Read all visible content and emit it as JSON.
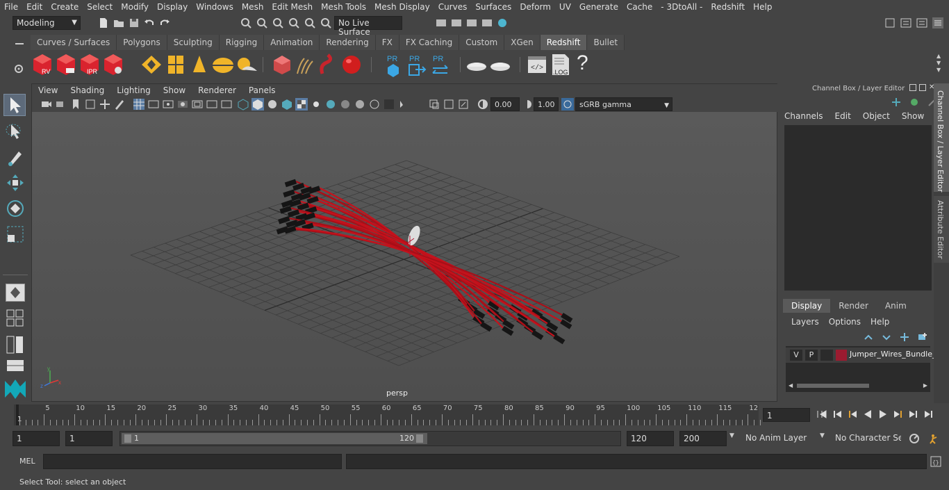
{
  "menubar": {
    "items": [
      "File",
      "Edit",
      "Create",
      "Select",
      "Modify",
      "Display",
      "Windows",
      "Mesh",
      "Edit Mesh",
      "Mesh Tools",
      "Mesh Display",
      "Curves",
      "Surfaces",
      "Deform",
      "UV",
      "Generate",
      "Cache",
      "- 3DtoAll -",
      "Redshift",
      "Help"
    ]
  },
  "statusline": {
    "mode": "Modeling",
    "live_surface": "No Live Surface"
  },
  "shelf": {
    "tabs": [
      "Curves / Surfaces",
      "Polygons",
      "Sculpting",
      "Rigging",
      "Animation",
      "Rendering",
      "FX",
      "FX Caching",
      "Custom",
      "XGen",
      "Redshift",
      "Bullet"
    ],
    "active_tab": "Redshift",
    "icons": {
      "rv": "RV",
      "ipr": "IPR",
      "pr": "PR",
      "log": ".LOG",
      "help": "?"
    }
  },
  "viewport": {
    "menu": [
      "View",
      "Shading",
      "Lighting",
      "Show",
      "Renderer",
      "Panels"
    ],
    "exposure": "0.00",
    "gamma": "1.00",
    "color_space": "sGRB gamma",
    "camera_label": "persp"
  },
  "channelbox": {
    "title": "Channel Box / Layer Editor",
    "menu": [
      "Channels",
      "Edit",
      "Object",
      "Show"
    ],
    "layer_tabs": [
      "Display",
      "Render",
      "Anim"
    ],
    "layer_menu": [
      "Layers",
      "Options",
      "Help"
    ],
    "layer": {
      "v": "V",
      "p": "P",
      "name": "Jumper_Wires_Bundle_",
      "color": "#9b1b30"
    }
  },
  "sidetabs": [
    "Channel Box / Layer Editor",
    "Attribute Editor"
  ],
  "timeline": {
    "ticks": [
      "5",
      "10",
      "15",
      "20",
      "25",
      "30",
      "35",
      "40",
      "45",
      "50",
      "55",
      "60",
      "65",
      "70",
      "75",
      "80",
      "85",
      "90",
      "95",
      "100",
      "105",
      "110",
      "115",
      "12"
    ],
    "start_label": "1",
    "current_frame": "1"
  },
  "range": {
    "start": "1",
    "start2": "1",
    "range_start": "1",
    "range_end": "120",
    "end": "120",
    "end2": "200",
    "anim_layer": "No Anim Layer",
    "character_set": "No Character Set"
  },
  "cmdline": {
    "label": "MEL"
  },
  "helpline": {
    "text": "Select Tool: select an object"
  }
}
